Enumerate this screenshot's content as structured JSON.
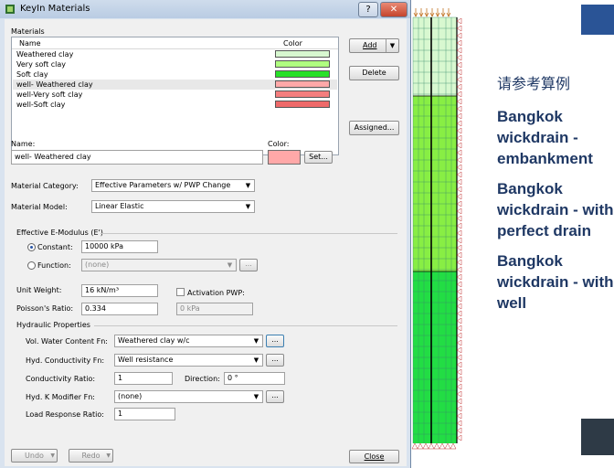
{
  "window": {
    "title": "KeyIn Materials",
    "help_label": "?",
    "close_label": "✕"
  },
  "materials": {
    "group_label": "Materials",
    "col_name": "Name",
    "col_color": "Color",
    "rows": [
      {
        "name": "Weathered clay",
        "color": "#d8f8d0"
      },
      {
        "name": "Very soft clay",
        "color": "#b0ff80"
      },
      {
        "name": "Soft clay",
        "color": "#28e028"
      },
      {
        "name": "well- Weathered clay",
        "color": "#ffa8a8",
        "selected": true
      },
      {
        "name": "well-Very soft clay",
        "color": "#f47e7e"
      },
      {
        "name": "well-Soft clay",
        "color": "#ee6a6a"
      }
    ]
  },
  "side_buttons": {
    "add": "Add",
    "delete": "Delete",
    "assigned": "Assigned..."
  },
  "name_field": {
    "label": "Name:",
    "value": "well- Weathered clay"
  },
  "color_field": {
    "label": "Color:",
    "swatch": "#ffa8a8",
    "set_label": "Set..."
  },
  "category": {
    "label": "Material Category:",
    "value": "Effective Parameters w/ PWP Change"
  },
  "model": {
    "label": "Material Model:",
    "value": "Linear Elastic"
  },
  "modulus": {
    "group_label": "Effective E-Modulus (E')",
    "constant_label": "Constant:",
    "constant_value": "10000 kPa",
    "function_label": "Function:",
    "function_value": "(none)",
    "function_btn": "..."
  },
  "unit_weight": {
    "label": "Unit Weight:",
    "value": "16 kN/m³"
  },
  "activation": {
    "label": "Activation PWP:",
    "value": "0 kPa"
  },
  "poisson": {
    "label": "Poisson's Ratio:",
    "value": "0.334"
  },
  "hydraulic": {
    "group_label": "Hydraulic Properties",
    "vwc_label": "Vol. Water Content Fn:",
    "vwc_value": "Weathered clay w/c",
    "vwc_btn": "...",
    "hydk_label": "Hyd. Conductivity Fn:",
    "hydk_value": "Well resistance",
    "hydk_btn": "...",
    "ratio_label": "Conductivity Ratio:",
    "ratio_value": "1",
    "direction_label": "Direction:",
    "direction_value": "0 °",
    "kmod_label": "Hyd. K Modifier Fn:",
    "kmod_value": "(none)",
    "kmod_btn": "...",
    "lrr_label": "Load Response Ratio:",
    "lrr_value": "1"
  },
  "footer": {
    "undo": "Undo",
    "redo": "Redo",
    "close": "Close"
  },
  "slide": {
    "chinese": "请参考算例",
    "items": [
      "Bangkok wickdrain - embankment",
      "Bangkok wickdrain - with perfect drain",
      "Bangkok wickdrain - with well"
    ]
  }
}
